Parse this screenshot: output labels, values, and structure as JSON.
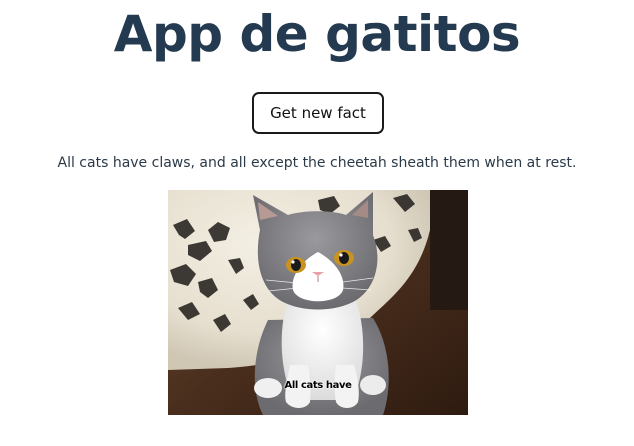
{
  "header": {
    "title": "App de gatitos"
  },
  "actions": {
    "new_fact_label": "Get new fact"
  },
  "fact": {
    "text": "All cats have claws, and all except the cheetah sheath them when at rest."
  },
  "cat_image": {
    "caption": "All cats have"
  },
  "colors": {
    "title": "#243a50",
    "text": "#2b3a48",
    "button_border": "#1a1a1a"
  }
}
